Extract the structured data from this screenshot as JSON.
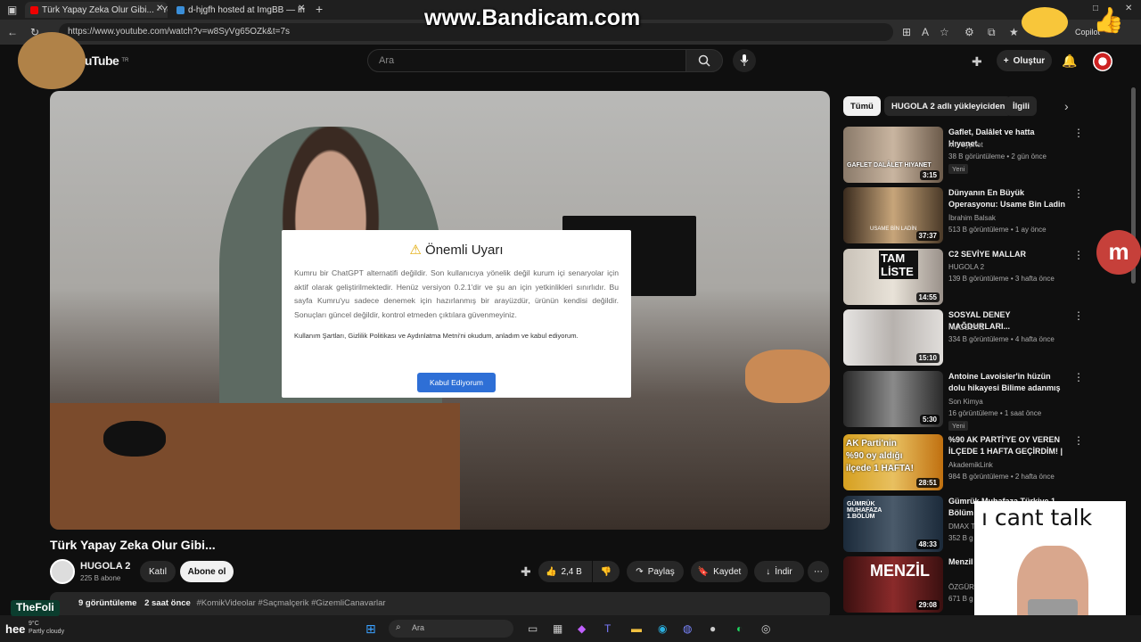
{
  "browser": {
    "tabs": [
      {
        "label": "Türk Yapay Zeka Olur Gibi... - You",
        "active": true
      },
      {
        "label": "d-hjgfh hosted at ImgBB — ImgB",
        "active": false
      }
    ],
    "url": "https://www.youtube.com/watch?v=w8SyVg65OZk&t=7s",
    "copilot_label": "Copilot"
  },
  "watermark": "www.Bandicam.com",
  "header": {
    "logo": "YouTube",
    "region": "TR",
    "search_placeholder": "Ara",
    "create_label": "Oluştur"
  },
  "modal": {
    "title": "Önemli Uyarı",
    "body": "Kumru bir ChatGPT alternatifi değildir. Son kullanıcıya yönelik değil kurum içi senaryolar için aktif olarak geliştirilmektedir. Henüz versiyon 0.2.1'dir ve şu an için yetkinlikleri sınırlıdır. Bu sayfa Kumru'yu sadece denemek için hazırlanmış bir arayüzdür, ürünün kendisi değildir. Sonuçları güncel değildir, kontrol etmeden çıktılara güvenmeyiniz.",
    "terms": "Kullanım Şartları, Gizlilik Politikası ve Aydınlatma Metni'ni okudum, anladım ve kabul ediyorum.",
    "button": "Kabul Ediyorum"
  },
  "video": {
    "title": "Türk Yapay Zeka Olur Gibi...",
    "channel": "HUGOLA 2",
    "subscribers": "225 B abone",
    "join_label": "Katıl",
    "subscribe_label": "Abone ol",
    "likes": "2,4 B",
    "share_label": "Paylaş",
    "save_label": "Kaydet",
    "download_label": "İndir",
    "views_partial": "9 görüntüleme",
    "time_ago": "2 saat önce",
    "hashtags": "#KomikVideolar #Saçmalçerik #GizemliCanavarlar"
  },
  "chips": [
    {
      "label": "Tümü",
      "selected": true
    },
    {
      "label": "HUGOLA 2 adlı yükleyiciden",
      "selected": false
    },
    {
      "label": "İlgili",
      "selected": false
    }
  ],
  "recommendations": [
    {
      "title": "Gaflet, Dalâlet ve hatta Hıyanet.",
      "channel": "Mr. Cypriot",
      "meta": "38 B görüntüleme • 2 gün önce",
      "badge": "Yeni",
      "duration": "3:15",
      "thumb_text": "GAFLET  DALÂLET  HIYANET"
    },
    {
      "title": "Dünyanın En Büyük Operasyonu: Usame Bin Ladin Gerçekten ...",
      "channel": "İbrahim Balsak",
      "meta": "513 B görüntüleme • 1 ay önce",
      "badge": "",
      "duration": "37:37",
      "thumb_text": "USAME BİN LADİN"
    },
    {
      "title": "C2 SEVİYE MALLAR",
      "channel": "HUGOLA 2",
      "meta": "139 B görüntüleme • 3 hafta önce",
      "badge": "",
      "duration": "14:55",
      "thumb_text": "TAM LİSTE"
    },
    {
      "title": "SOSYAL DENEY MAĞDURLARI...",
      "channel": "HUGOLA 2",
      "meta": "334 B görüntüleme • 4 hafta önce",
      "badge": "",
      "duration": "15:10",
      "thumb_text": ""
    },
    {
      "title": "Antoine Lavoisier'in hüzün dolu hikayesi Bilime adanmış bir ...",
      "channel": "Son Kimya",
      "meta": "16 görüntüleme • 1 saat önce",
      "badge": "Yeni",
      "duration": "5:30",
      "thumb_text": ""
    },
    {
      "title": "%90 AK PARTİ'YE OY VEREN İLÇEDE 1 HAFTA GEÇİRDİM! | ...",
      "channel": "AkademikLink",
      "meta": "984 B görüntüleme • 2 hafta önce",
      "badge": "",
      "duration": "28:51",
      "thumb_text": "AK Parti'nin %90 oy aldığı ilçede 1 HAFTA!"
    },
    {
      "title": "Gümrük Muhafaza Türkiye 1. Bölüm",
      "channel": "DMAX Tü",
      "meta": "352 B g",
      "badge": "",
      "duration": "48:33",
      "thumb_text": "GÜMRÜK MUHAFAZA 1.BÖLÜM"
    },
    {
      "title": "Menzil Tarikat",
      "channel": "ÖZGÜR",
      "meta": "671 B g",
      "badge": "",
      "duration": "29:08",
      "thumb_text": "MENZİL"
    }
  ],
  "overlay_text": "ı cant talk",
  "taskbar": {
    "weather_temp": "9°C",
    "weather_desc": "Partly cloudy",
    "search_label": "Ara",
    "stream_label": "TheFoli",
    "left_text": "hee"
  }
}
